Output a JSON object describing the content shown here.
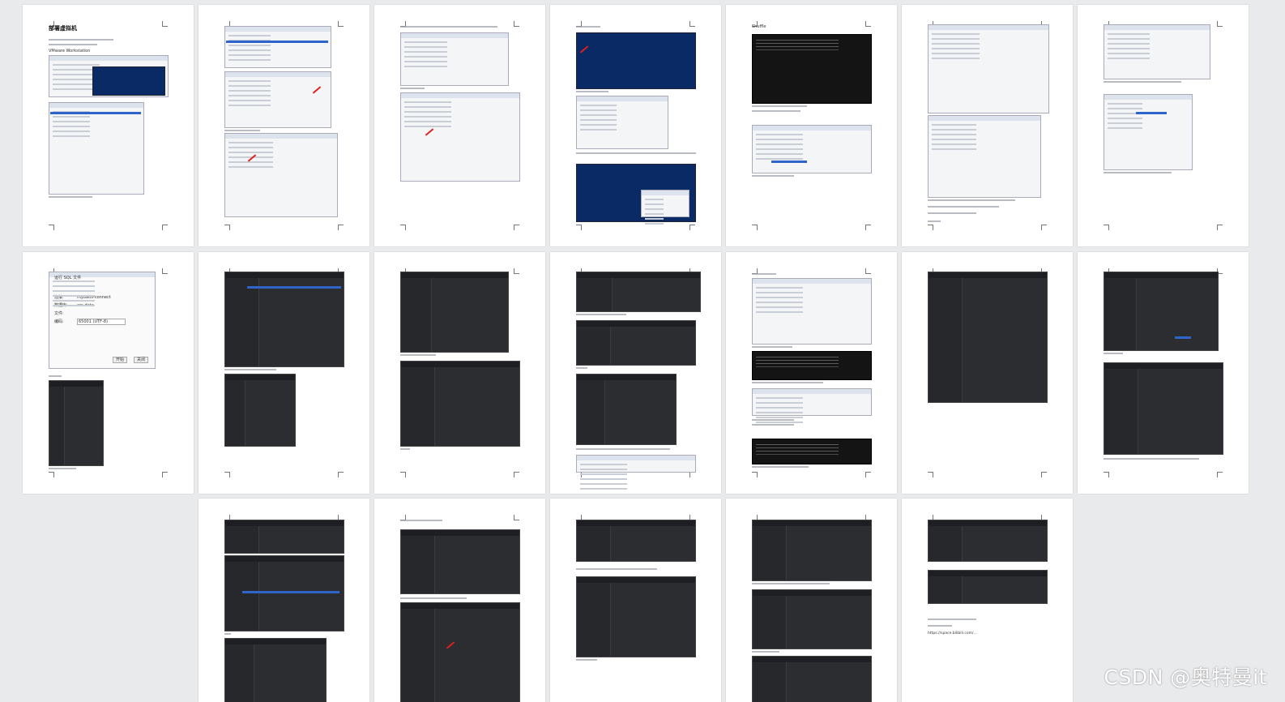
{
  "document": {
    "pages_row1": [
      "page-1",
      "page-2",
      "page-3",
      "page-4",
      "page-5",
      "page-6",
      "page-7"
    ],
    "pages_row2": [
      "page-8",
      "page-9",
      "page-10",
      "page-11",
      "page-12",
      "page-13",
      "page-14"
    ],
    "pages_row3": [
      "page-15",
      "page-16",
      "page-17",
      "page-18",
      "page-19"
    ]
  },
  "page1": {
    "title": "VMware Workstation"
  },
  "page5": {
    "heading": "Shuffle"
  },
  "page8": {
    "dialog_title": "运行 SQL 文件",
    "label_connect": "连接:",
    "value_connect": "mybatis-connect",
    "label_db": "数据库:",
    "value_db": "ars-data",
    "label_file": "文件:",
    "label_encoding": "编码:",
    "value_encoding": "65001 (UTF-8)",
    "btn_start": "开始",
    "btn_close": "关闭"
  },
  "page19": {
    "text_link": "https://space.bilibili.com/..."
  },
  "watermark": "CSDN @奥特曼it"
}
